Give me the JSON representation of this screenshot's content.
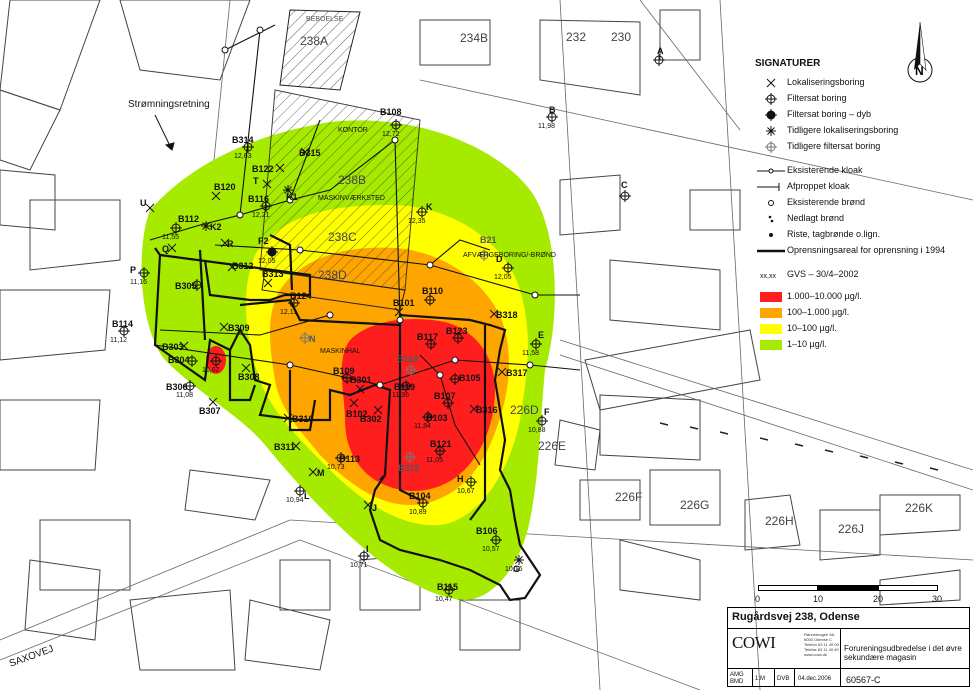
{
  "map": {
    "flow_label": "Strømningsretning",
    "street": "SAXOVEJ",
    "buildings": [
      {
        "id": "b-238a",
        "label": "238A"
      },
      {
        "id": "b-238b",
        "label": "238B"
      },
      {
        "id": "b-238c",
        "label": "238C"
      },
      {
        "id": "b-238d",
        "label": "238D"
      },
      {
        "id": "b-234b",
        "label": "234B"
      },
      {
        "id": "b-232",
        "label": "232"
      },
      {
        "id": "b-230",
        "label": "230"
      },
      {
        "id": "b-226d",
        "label": "226D"
      },
      {
        "id": "b-226e",
        "label": "226E"
      },
      {
        "id": "b-226f",
        "label": "226F"
      },
      {
        "id": "b-226g",
        "label": "226G"
      },
      {
        "id": "b-226h",
        "label": "226H"
      },
      {
        "id": "b-226j",
        "label": "226J"
      },
      {
        "id": "b-226k",
        "label": "226K"
      }
    ],
    "text_labels": [
      {
        "id": "t-beboelse",
        "label": "BEBOELSE"
      },
      {
        "id": "t-maskinv",
        "label": "MASKINVÆRKSTED"
      },
      {
        "id": "t-maskinhal",
        "label": "MASKINHAL"
      },
      {
        "id": "t-afvaerge",
        "label": "AFVÆRGEBORING/-BRØND"
      },
      {
        "id": "t-kontor",
        "label": "KONTOR"
      }
    ],
    "borings": [
      {
        "id": "B108",
        "value": "12,72"
      },
      {
        "id": "B",
        "value": "11,98"
      },
      {
        "id": "A",
        "value": ""
      },
      {
        "id": "B314",
        "value": "12,63"
      },
      {
        "id": "B122",
        "value": ""
      },
      {
        "id": "B315",
        "value": ""
      },
      {
        "id": "B120",
        "value": ""
      },
      {
        "id": "B116",
        "value": "12,21"
      },
      {
        "id": "K1",
        "value": ""
      },
      {
        "id": "T",
        "value": ""
      },
      {
        "id": "K",
        "value": "12,35"
      },
      {
        "id": "C",
        "value": ""
      },
      {
        "id": "U",
        "value": ""
      },
      {
        "id": "B112",
        "value": "11,55"
      },
      {
        "id": "K2",
        "value": ""
      },
      {
        "id": "F2",
        "value": "12,05"
      },
      {
        "id": "R",
        "value": ""
      },
      {
        "id": "Q",
        "value": ""
      },
      {
        "id": "B21",
        "value": ""
      },
      {
        "id": "D",
        "value": "12,05"
      },
      {
        "id": "P",
        "value": "11,16"
      },
      {
        "id": "B305",
        "value": ""
      },
      {
        "id": "B313",
        "value": ""
      },
      {
        "id": "B312",
        "value": ""
      },
      {
        "id": "B110",
        "value": ""
      },
      {
        "id": "B124",
        "value": "12,11"
      },
      {
        "id": "B101",
        "value": ""
      },
      {
        "id": "B318",
        "value": ""
      },
      {
        "id": "B114",
        "value": "11,12"
      },
      {
        "id": "B304",
        "value": ""
      },
      {
        "id": "B309",
        "value": ""
      },
      {
        "id": "B123",
        "value": ""
      },
      {
        "id": "B117",
        "value": ""
      },
      {
        "id": "E",
        "value": "11,58"
      },
      {
        "id": "B303",
        "value": ""
      },
      {
        "id": "B306",
        "value": "11,08"
      },
      {
        "id": "B307",
        "value": ""
      },
      {
        "id": "B308",
        "value": ""
      },
      {
        "id": "N",
        "value": ""
      },
      {
        "id": "B118",
        "value": ""
      },
      {
        "id": "B105",
        "value": ""
      },
      {
        "id": "B317",
        "value": ""
      },
      {
        "id": "B109",
        "value": ""
      },
      {
        "id": "B301",
        "value": ""
      },
      {
        "id": "B119",
        "value": "11,36"
      },
      {
        "id": "B107",
        "value": ""
      },
      {
        "id": "B103",
        "value": "11,84"
      },
      {
        "id": "B316",
        "value": ""
      },
      {
        "id": "F",
        "value": "10,88"
      },
      {
        "id": "B102",
        "value": ""
      },
      {
        "id": "B302",
        "value": ""
      },
      {
        "id": "B310",
        "value": ""
      },
      {
        "id": "B311",
        "value": ""
      },
      {
        "id": "B113",
        "value": "10,73"
      },
      {
        "id": "B121",
        "value": "11,05"
      },
      {
        "id": "B319",
        "value": ""
      },
      {
        "id": "M",
        "value": ""
      },
      {
        "id": "H",
        "value": "10,67"
      },
      {
        "id": "L",
        "value": "10,94"
      },
      {
        "id": "B104",
        "value": "10,89"
      },
      {
        "id": "J",
        "value": ""
      },
      {
        "id": "B106",
        "value": "10,57"
      },
      {
        "id": "G",
        "value": "10,16"
      },
      {
        "id": "I",
        "value": "10,71"
      },
      {
        "id": "B115",
        "value": "10,47"
      },
      {
        "id": "B-small",
        "value": "10,62"
      }
    ]
  },
  "legend": {
    "title": "SIGNATURER",
    "items": [
      {
        "icon": "x-cross-icon",
        "label": "Lokaliseringsboring"
      },
      {
        "icon": "circle-plus-icon",
        "label": "Filtersat boring"
      },
      {
        "icon": "filled-circle-plus-icon",
        "label": "Filtersat boring – dyb"
      },
      {
        "icon": "asterisk-icon",
        "label": "Tidligere lokaliseringsboring"
      },
      {
        "icon": "gray-circle-plus-icon",
        "label": "Tidligere filtersat boring",
        "tall": true
      },
      {
        "icon": "sewer-line-icon",
        "label": "Eksisterende kloak"
      },
      {
        "icon": "plugged-sewer-icon",
        "label": "Afproppet kloak"
      },
      {
        "icon": "open-circle-icon",
        "label": "Eksisterende brønd"
      },
      {
        "icon": "dot-pair-icon",
        "label": "Nedlagt brønd"
      },
      {
        "icon": "small-dot-icon",
        "label": "Riste, tagbrønde o.lign."
      },
      {
        "icon": "thick-line-icon",
        "label": "Oprensningsareal for oprensning i 1994",
        "tall": true
      },
      {
        "icon": "gvs-icon",
        "label": "GVS – 30/4–2002",
        "sym_text": "xx,xx"
      }
    ],
    "concentration": [
      {
        "label": "1.000–10.000 µg/l.",
        "color": "#ff1e1e"
      },
      {
        "label": "100–1.000 µg/l.",
        "color": "#ffa500"
      },
      {
        "label": "10–100 µg/l.",
        "color": "#ffff00"
      },
      {
        "label": "1–10 µg/l.",
        "color": "#a6ea00"
      }
    ]
  },
  "scale": {
    "ticks": [
      "0",
      "10",
      "20",
      "30"
    ]
  },
  "titleblock": {
    "project": "Rugårdsvej 238, Odense",
    "company": "COWI",
    "address": "Rønnekrogen 5A\n5000 Odense C\nTelefon 63 11 49 00\nTelefax 63 11 49 49\nwww.cowi.dk",
    "description": "Forureningsudbredelse i det øvre sekundære magasin",
    "date": "04.dec.2006",
    "drawing_no": "60567-C",
    "init1": "AMG",
    "init2": "BMD",
    "scale": "1:M",
    "by": "DVB"
  },
  "colors": {
    "red": "#ff1e1e",
    "orange": "#ffa500",
    "yellow": "#ffff00",
    "green": "#a6ea00"
  }
}
